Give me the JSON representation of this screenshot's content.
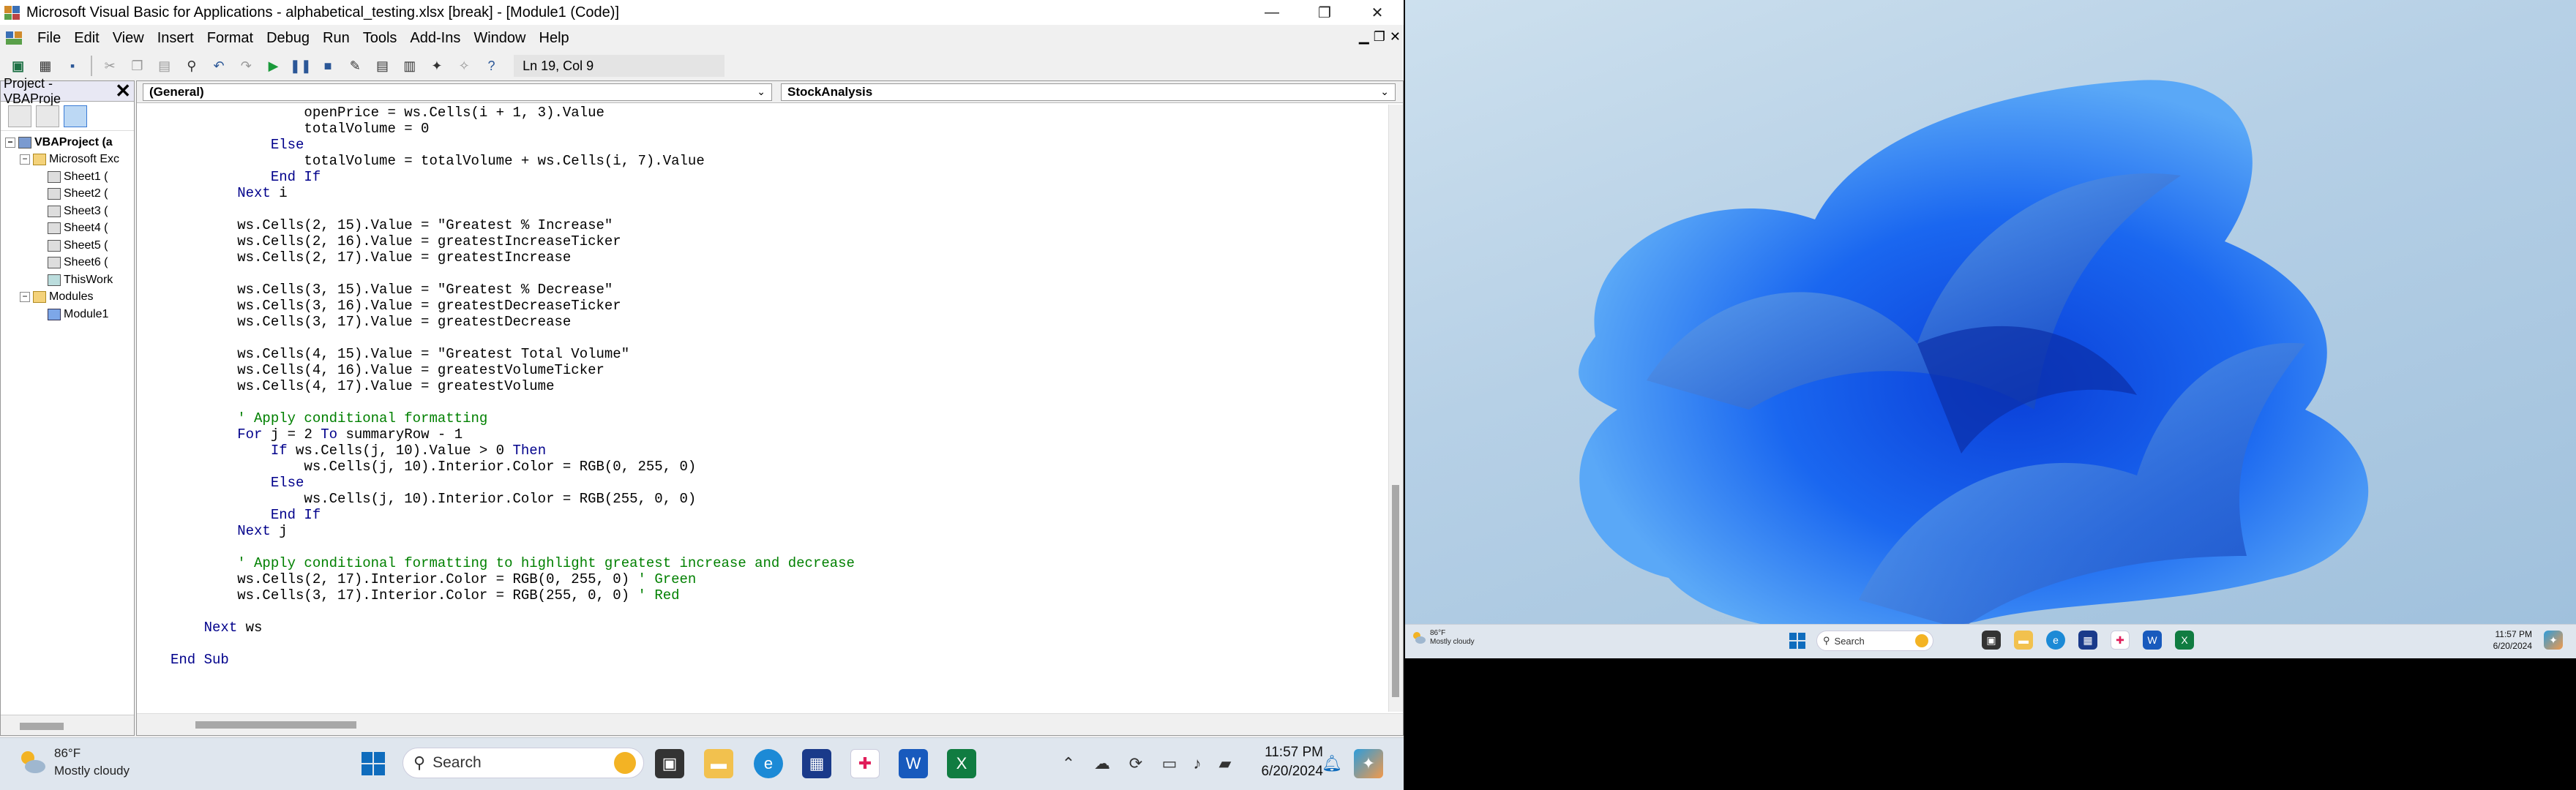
{
  "window": {
    "title": "Microsoft Visual Basic for Applications - alphabetical_testing.xlsx [break] - [Module1 (Code)]",
    "min_glyph": "—",
    "max_glyph": "❐",
    "close_glyph": "✕"
  },
  "menu": {
    "items": [
      "File",
      "Edit",
      "View",
      "Insert",
      "Format",
      "Debug",
      "Run",
      "Tools",
      "Add-Ins",
      "Window",
      "Help"
    ],
    "mdi_min": "▁",
    "mdi_restore": "❐",
    "mdi_close": "✕"
  },
  "toolbar": {
    "position_text": "Ln 19, Col 9"
  },
  "project": {
    "title": "Project - VBAProje",
    "close_glyph": "✕",
    "tree": [
      {
        "label": "VBAProject (a",
        "level": 0,
        "icon": "project",
        "bold": true
      },
      {
        "label": "Microsoft Exc",
        "level": 1,
        "icon": "folder"
      },
      {
        "label": "Sheet1 (",
        "level": 2,
        "icon": "sheet"
      },
      {
        "label": "Sheet2 (",
        "level": 2,
        "icon": "sheet"
      },
      {
        "label": "Sheet3 (",
        "level": 2,
        "icon": "sheet"
      },
      {
        "label": "Sheet4 (",
        "level": 2,
        "icon": "sheet"
      },
      {
        "label": "Sheet5 (",
        "level": 2,
        "icon": "sheet"
      },
      {
        "label": "Sheet6 (",
        "level": 2,
        "icon": "sheet"
      },
      {
        "label": "ThisWork",
        "level": 2,
        "icon": "sheet"
      },
      {
        "label": "Modules",
        "level": 1,
        "icon": "folder"
      },
      {
        "label": "Module1",
        "level": 2,
        "icon": "module"
      }
    ]
  },
  "code": {
    "object_combo": "(General)",
    "proc_combo": "StockAnalysis",
    "lines": [
      {
        "t": "                openPrice = ws.Cells(i + 1, 3).Value",
        "k": ""
      },
      {
        "t": "                totalVolume = 0",
        "k": ""
      },
      {
        "t": "            Else",
        "k": "kw"
      },
      {
        "t": "                totalVolume = totalVolume + ws.Cells(i, 7).Value",
        "k": ""
      },
      {
        "t": "            End If",
        "k": "kw"
      },
      {
        "t": "        Next i",
        "k": "kwmix"
      },
      {
        "t": "",
        "k": ""
      },
      {
        "t": "        ws.Cells(2, 15).Value = \"Greatest % Increase\"",
        "k": ""
      },
      {
        "t": "        ws.Cells(2, 16).Value = greatestIncreaseTicker",
        "k": ""
      },
      {
        "t": "        ws.Cells(2, 17).Value = greatestIncrease",
        "k": ""
      },
      {
        "t": "",
        "k": ""
      },
      {
        "t": "        ws.Cells(3, 15).Value = \"Greatest % Decrease\"",
        "k": ""
      },
      {
        "t": "        ws.Cells(3, 16).Value = greatestDecreaseTicker",
        "k": ""
      },
      {
        "t": "        ws.Cells(3, 17).Value = greatestDecrease",
        "k": ""
      },
      {
        "t": "",
        "k": ""
      },
      {
        "t": "        ws.Cells(4, 15).Value = \"Greatest Total Volume\"",
        "k": ""
      },
      {
        "t": "        ws.Cells(4, 16).Value = greatestVolumeTicker",
        "k": ""
      },
      {
        "t": "        ws.Cells(4, 17).Value = greatestVolume",
        "k": ""
      },
      {
        "t": "",
        "k": ""
      },
      {
        "t": "        ' Apply conditional formatting",
        "k": "cm"
      },
      {
        "t": "        For j = 2 To summaryRow - 1",
        "k": "kwmix"
      },
      {
        "t": "            If ws.Cells(j, 10).Value > 0 Then",
        "k": "kwmix"
      },
      {
        "t": "                ws.Cells(j, 10).Interior.Color = RGB(0, 255, 0)",
        "k": ""
      },
      {
        "t": "            Else",
        "k": "kw"
      },
      {
        "t": "                ws.Cells(j, 10).Interior.Color = RGB(255, 0, 0)",
        "k": ""
      },
      {
        "t": "            End If",
        "k": "kw"
      },
      {
        "t": "        Next j",
        "k": "kwmix"
      },
      {
        "t": "",
        "k": ""
      },
      {
        "t": "        ' Apply conditional formatting to highlight greatest increase and decrease",
        "k": "cm"
      },
      {
        "t": "        ws.Cells(2, 17).Interior.Color = RGB(0, 255, 0) ' Green",
        "k": "cmtail"
      },
      {
        "t": "        ws.Cells(3, 17).Interior.Color = RGB(255, 0, 0) ' Red",
        "k": "cmtail"
      },
      {
        "t": "",
        "k": ""
      },
      {
        "t": "    Next ws",
        "k": "kwmix"
      },
      {
        "t": "",
        "k": ""
      },
      {
        "t": "End Sub",
        "k": "kw"
      }
    ]
  },
  "taskbar_left": {
    "temp": "86°F",
    "weather": "Mostly cloudy",
    "search_placeholder": "Search",
    "time": "11:57 PM",
    "date": "6/20/2024"
  },
  "taskbar_right": {
    "temp": "86°F",
    "weather": "Mostly cloudy",
    "search_placeholder": "Search",
    "time": "11:57 PM",
    "date": "6/20/2024"
  },
  "colors": {
    "keyword": "#00008b",
    "comment": "#008000",
    "accent": "#0f6cbd"
  }
}
